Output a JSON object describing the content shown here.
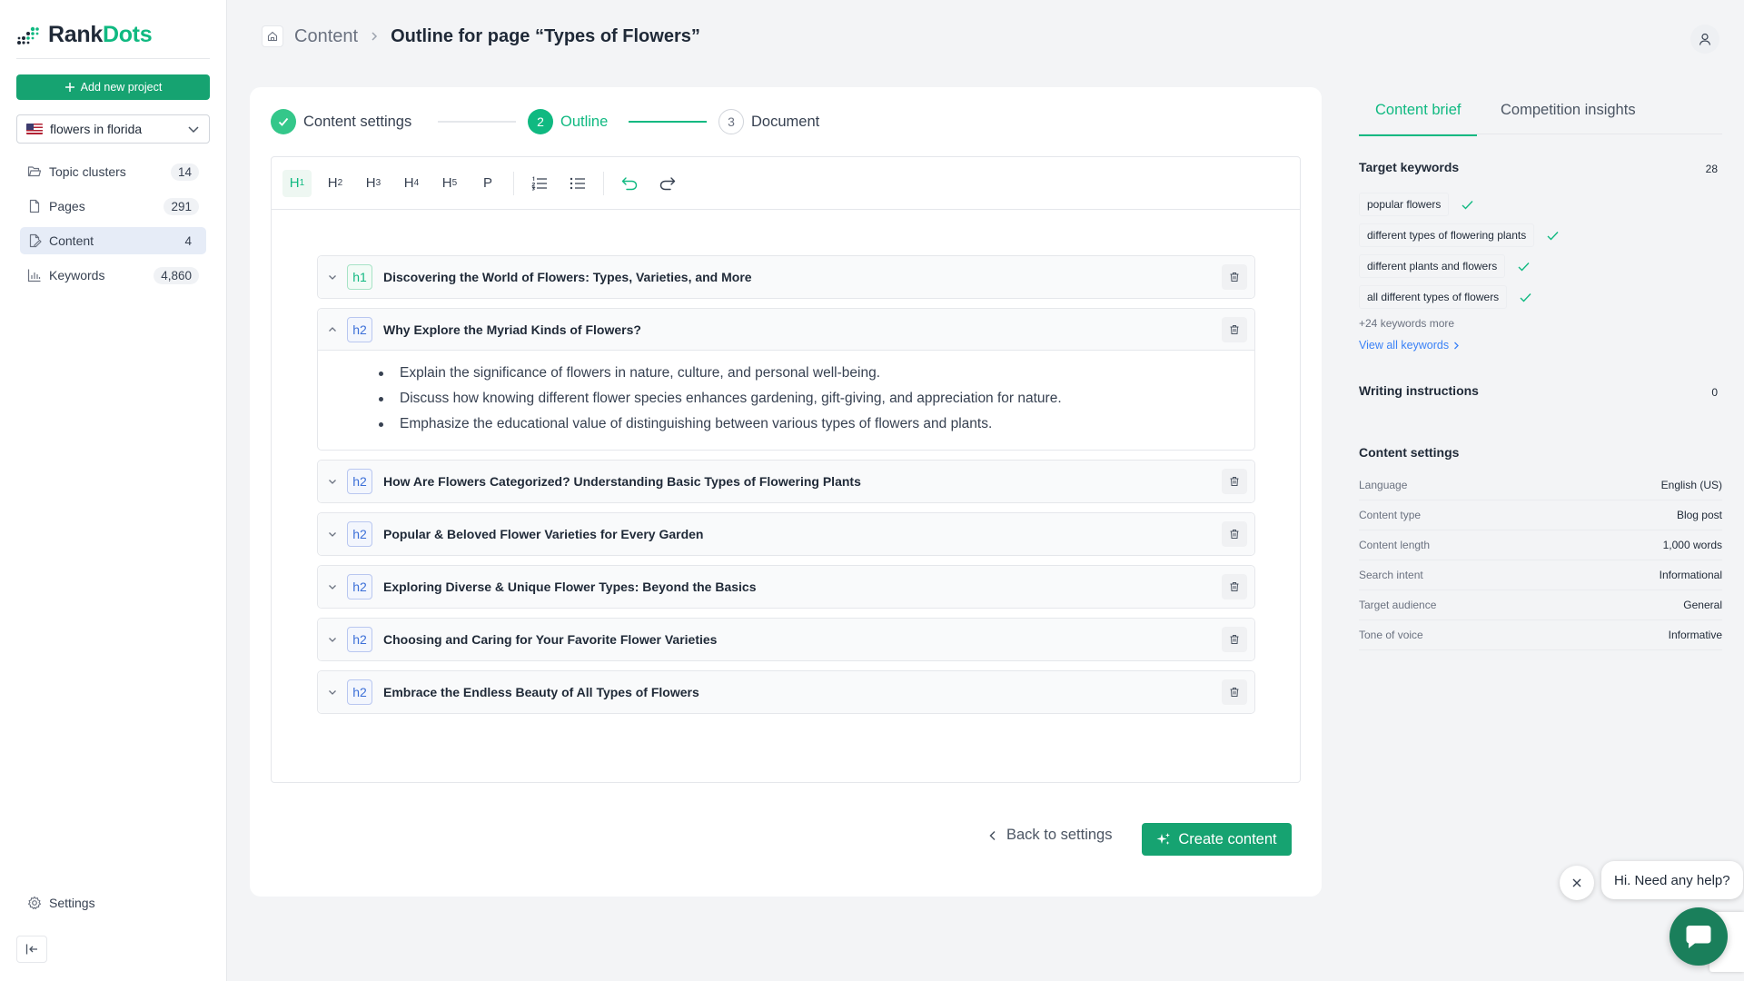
{
  "app": {
    "logo_part1": "Rank",
    "logo_part2": "Dots",
    "brand_color": "#10b981"
  },
  "sidebar": {
    "add_project_label": "Add new project",
    "project_selector": {
      "value": "flowers in florida",
      "flag": "us-flag-icon"
    },
    "items": [
      {
        "label": "Topic clusters",
        "count": "14",
        "icon": "folder-icon"
      },
      {
        "label": "Pages",
        "count": "291",
        "icon": "file-icon"
      },
      {
        "label": "Content",
        "count": "4",
        "icon": "edit-file-icon",
        "active": true
      },
      {
        "label": "Keywords",
        "count": "4,860",
        "icon": "bar-chart-icon"
      }
    ],
    "settings_label": "Settings"
  },
  "header": {
    "breadcrumb": "Content",
    "title": "Outline for page “Types of Flowers”"
  },
  "steps": [
    {
      "label": "Content settings",
      "status": "done"
    },
    {
      "number": "2",
      "label": "Outline",
      "status": "current"
    },
    {
      "number": "3",
      "label": "Document",
      "status": "upcoming"
    }
  ],
  "toolbar": {
    "headings": [
      {
        "main": "H",
        "sub": "1"
      },
      {
        "main": "H",
        "sub": "2"
      },
      {
        "main": "H",
        "sub": "3"
      },
      {
        "main": "H",
        "sub": "4"
      },
      {
        "main": "H",
        "sub": "5"
      }
    ],
    "paragraph": "P"
  },
  "outline": [
    {
      "tag": "h1",
      "title": "Discovering the World of Flowers: Types, Varieties, and More",
      "expanded": false
    },
    {
      "tag": "h2",
      "title": "Why Explore the Myriad Kinds of Flowers?",
      "expanded": true,
      "bullets": [
        "Explain the significance of flowers in nature, culture, and personal well-being.",
        "Discuss how knowing different flower species enhances gardening, gift-giving, and appreciation for nature.",
        "Emphasize the educational value of distinguishing between various types of flowers and plants."
      ]
    },
    {
      "tag": "h2",
      "title": "How Are Flowers Categorized? Understanding Basic Types of Flowering Plants",
      "expanded": false
    },
    {
      "tag": "h2",
      "title": "Popular & Beloved Flower Varieties for Every Garden",
      "expanded": false
    },
    {
      "tag": "h2",
      "title": "Exploring Diverse & Unique Flower Types: Beyond the Basics",
      "expanded": false
    },
    {
      "tag": "h2",
      "title": "Choosing and Caring for Your Favorite Flower Varieties",
      "expanded": false
    },
    {
      "tag": "h2",
      "title": "Embrace the Endless Beauty of All Types of Flowers",
      "expanded": false
    }
  ],
  "actions": {
    "back_label": "Back to settings",
    "create_label": "Create content"
  },
  "right_panel": {
    "tabs": [
      "Content brief",
      "Competition insights"
    ],
    "target_keywords": {
      "title": "Target keywords",
      "count": "28",
      "items": [
        "popular flowers",
        "different types of flowering plants",
        "different plants and flowers",
        "all different types of flowers"
      ],
      "more": "+24 keywords more",
      "view_all": "View all keywords"
    },
    "writing_instructions": {
      "title": "Writing instructions",
      "count": "0"
    },
    "content_settings": {
      "title": "Content settings",
      "rows": [
        {
          "k": "Language",
          "v": "English (US)"
        },
        {
          "k": "Content type",
          "v": "Blog post"
        },
        {
          "k": "Content length",
          "v": "1,000 words"
        },
        {
          "k": "Search intent",
          "v": "Informational"
        },
        {
          "k": "Target audience",
          "v": "General"
        },
        {
          "k": "Tone of voice",
          "v": "Informative"
        }
      ]
    }
  },
  "chat": {
    "bubble_text": "Hi. Need any help?"
  }
}
